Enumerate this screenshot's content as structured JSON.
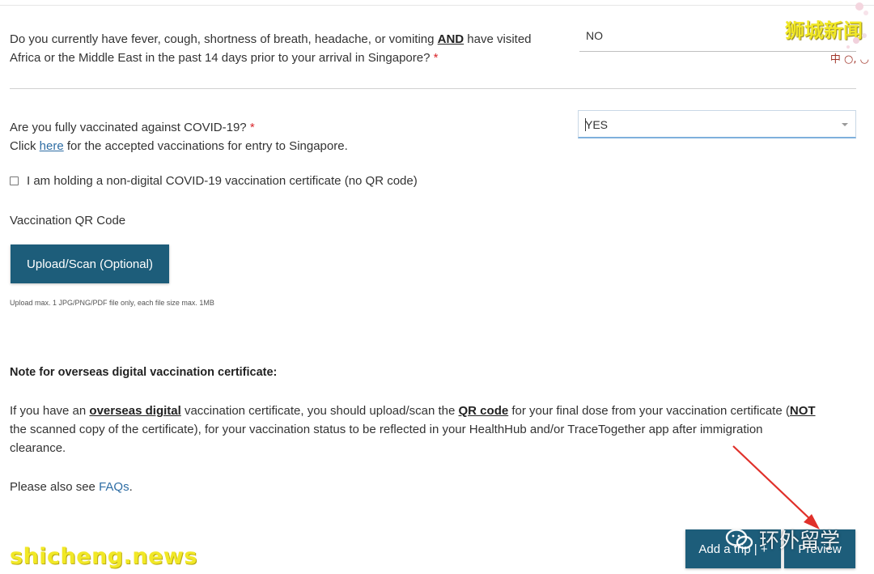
{
  "q1": {
    "line1_pre": "Do you currently have fever, cough, shortness of breath, headache, or vomiting ",
    "line1_bold": "AND",
    "line1_post": " have visited",
    "line2": "Africa or the Middle East in the past 14 days prior to your arrival in Singapore?",
    "required_mark": "*",
    "answer": "NO"
  },
  "q2": {
    "question": "Are you fully vaccinated against COVID-19?",
    "required_mark": "*",
    "click_pre": "Click ",
    "link": "here",
    "click_post": " for the accepted vaccinations for entry to Singapore.",
    "answer": "YES"
  },
  "checkbox": {
    "label": "I am holding a non-digital COVID-19 vaccination certificate (no QR code)",
    "checked": false
  },
  "qr": {
    "label": "Vaccination QR Code",
    "button": "Upload/Scan (Optional)",
    "hint": "Upload max. 1 JPG/PNG/PDF file only, each file size max. 1MB"
  },
  "note": {
    "title": "Note for overseas digital vaccination certificate:",
    "p1_a": "If you have an ",
    "p1_b": "overseas digital",
    "p1_c": " vaccination certificate, you should upload/scan the ",
    "p1_d": "QR code",
    "p1_e": " for your final dose from your vaccination certificate (",
    "p1_f": "NOT",
    "p1_line2": "the scanned copy of the certificate), for your vaccination status to be reflected in your HealthHub and/or TraceTogether app after immigration",
    "p1_line3": "clearance.",
    "p2_pre": "Please also see ",
    "p2_link": "FAQs",
    "p2_post": "."
  },
  "buttons": {
    "add_trip": "Add a trip | +",
    "preview": "Preview"
  },
  "watermarks": {
    "top_right": "狮城新闻",
    "bottom_left": "shicheng.news",
    "bottom_center": "环外留学",
    "corner": "中 ○, ◡"
  },
  "colors": {
    "primary_button": "#1d5d7a",
    "link": "#2e6da4",
    "required": "#d9262b",
    "arrow": "#e0302a",
    "watermark": "#f1e826"
  }
}
